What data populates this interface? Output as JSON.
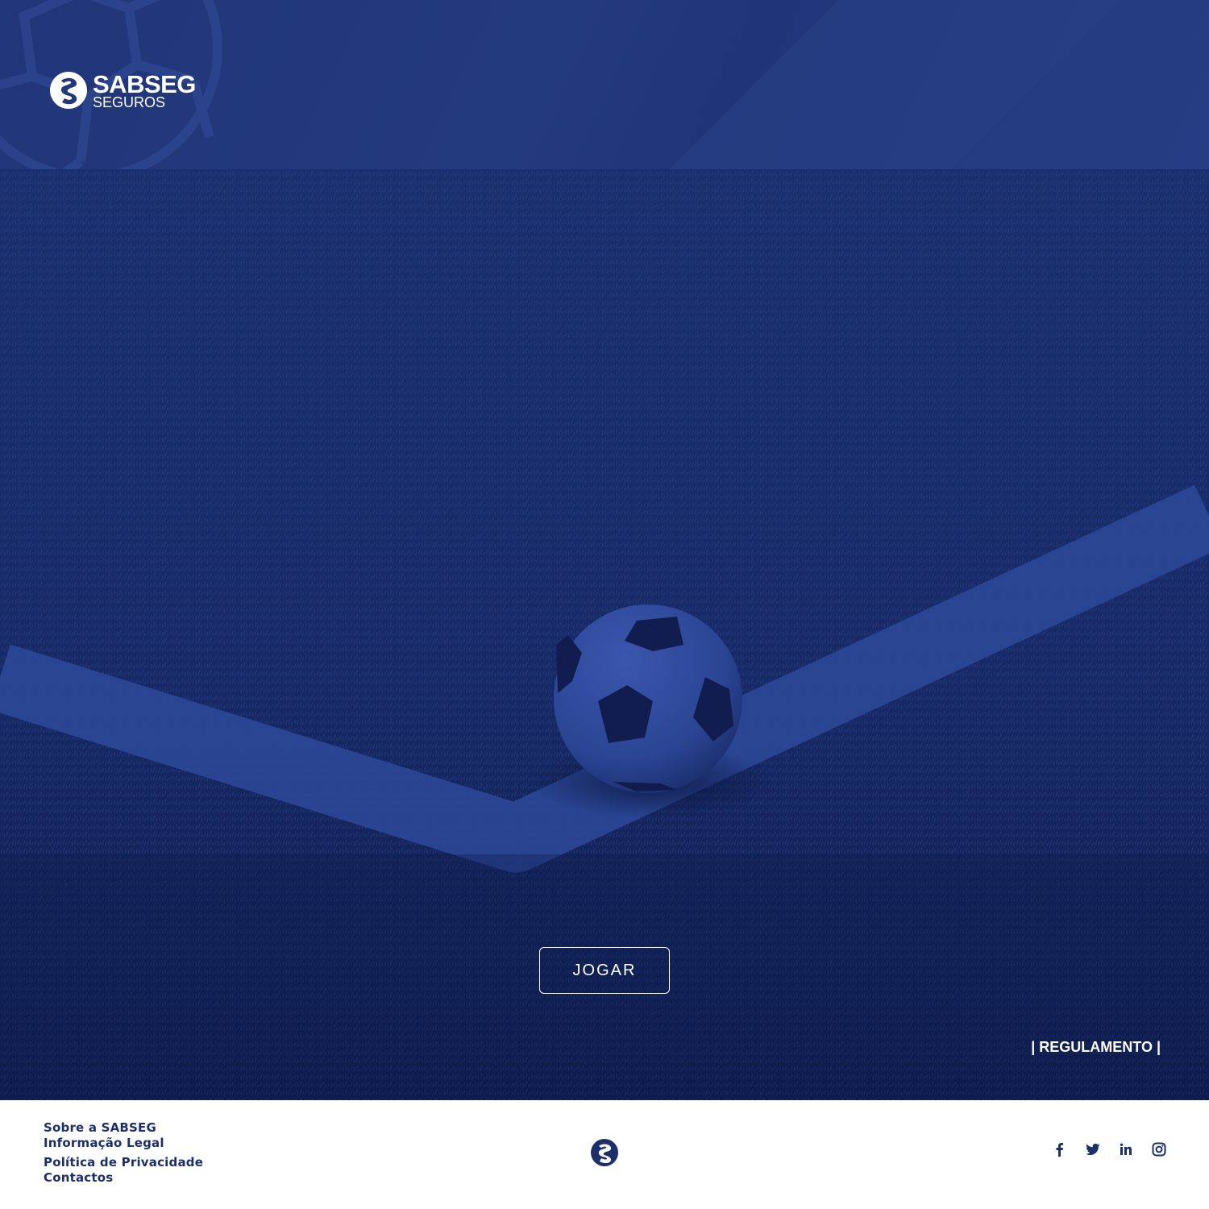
{
  "brand": {
    "name": "SABSEG",
    "tagline": "SEGUROS"
  },
  "hero": {
    "play_label": "JOGAR",
    "rules_label": "| REGULAMENTO |"
  },
  "footer": {
    "links": [
      "Sobre a SABSEG",
      "Informação Legal",
      "Política de Privacidade",
      "Contactos"
    ],
    "socials": [
      "facebook-icon",
      "twitter-icon",
      "linkedin-icon",
      "instagram-icon"
    ]
  },
  "colors": {
    "header_blue": "#223879",
    "field_blue": "#172a66",
    "footer_text": "#1d2f6b",
    "white": "#ffffff"
  }
}
